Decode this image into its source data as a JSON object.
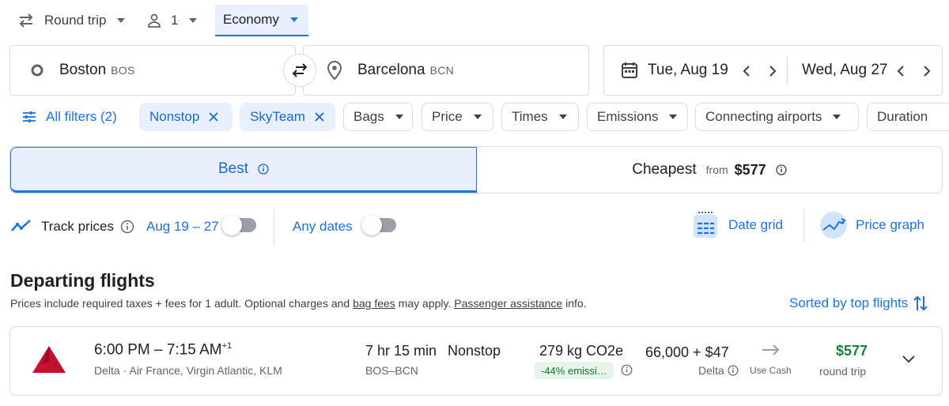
{
  "top_bar": {
    "trip_type": "Round trip",
    "passengers": "1",
    "cabin_class": "Economy"
  },
  "search": {
    "origin_city": "Boston",
    "origin_code": "BOS",
    "destination_city": "Barcelona",
    "destination_code": "BCN",
    "depart_date": "Tue, Aug 19",
    "return_date": "Wed, Aug 27"
  },
  "filters": {
    "all_filters": "All filters (2)",
    "chips": [
      "Nonstop",
      "SkyTeam",
      "Bags",
      "Price",
      "Times",
      "Emissions",
      "Connecting airports",
      "Duration"
    ]
  },
  "sort_tabs": {
    "best": "Best",
    "cheapest": "Cheapest",
    "cheapest_from": "from",
    "cheapest_price": "$577"
  },
  "tracking": {
    "track_prices": "Track prices",
    "date_range": "Aug 19 – 27",
    "any_dates": "Any dates",
    "date_grid": "Date grid",
    "price_graph": "Price graph"
  },
  "results": {
    "heading": "Departing flights",
    "note_before": "Prices include required taxes + fees for 1 adult. Optional charges and ",
    "note_link1": "bag fees",
    "note_mid": " may apply. ",
    "note_link2": "Passenger assistance",
    "note_after": " info.",
    "sorted_by": "Sorted by top flights"
  },
  "flights": [
    {
      "times": "6:00 PM – 7:15 AM",
      "day_offset": "+1",
      "airlines": "Delta · Air France, Virgin Atlantic, KLM",
      "duration": "7 hr 15 min",
      "route": "BOS–BCN",
      "stops": "Nonstop",
      "emissions": "279 kg CO2e",
      "emissions_badge": "-44% emissi…",
      "miles": "66,000 + $47",
      "miles_airline": "Delta",
      "use_cash": "Use Cash",
      "price": "$577",
      "price_note": "round trip"
    }
  ],
  "colors": {
    "accent": "#1a73e8",
    "price_green": "#188038",
    "delta_red": "#c8102e"
  }
}
